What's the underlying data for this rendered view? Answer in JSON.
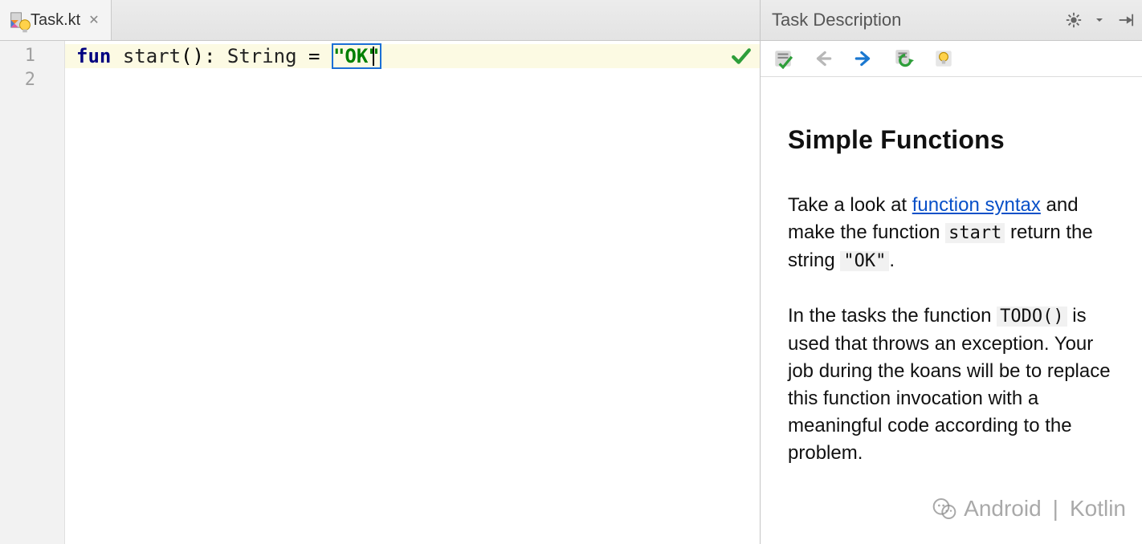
{
  "editor": {
    "tab_filename": "Task.kt",
    "line_numbers": [
      "1",
      "2"
    ],
    "code": {
      "kw_fun": "fun",
      "space1": " ",
      "fn_name": "start",
      "parens": "()",
      "colon_space": ": ",
      "type": "String",
      "space_eq_space": " = ",
      "string_lit": "\"OK\""
    }
  },
  "panel": {
    "title": "Task Description",
    "heading": "Simple Functions",
    "p1_part1": "Take a look at ",
    "p1_link": "function syntax",
    "p1_part2": " and make the function ",
    "p1_code1": "start",
    "p1_part3": " return the string ",
    "p1_code2": "\"OK\"",
    "p1_part4": ".",
    "p2_part1": "In the tasks the function ",
    "p2_code1": "TODO()",
    "p2_part2": " is used that throws an exception. Your job during the koans will be to replace this function invocation with a meaningful code according to the problem."
  },
  "watermark": {
    "left": "Android",
    "sep": "|",
    "right": "Kotlin"
  }
}
